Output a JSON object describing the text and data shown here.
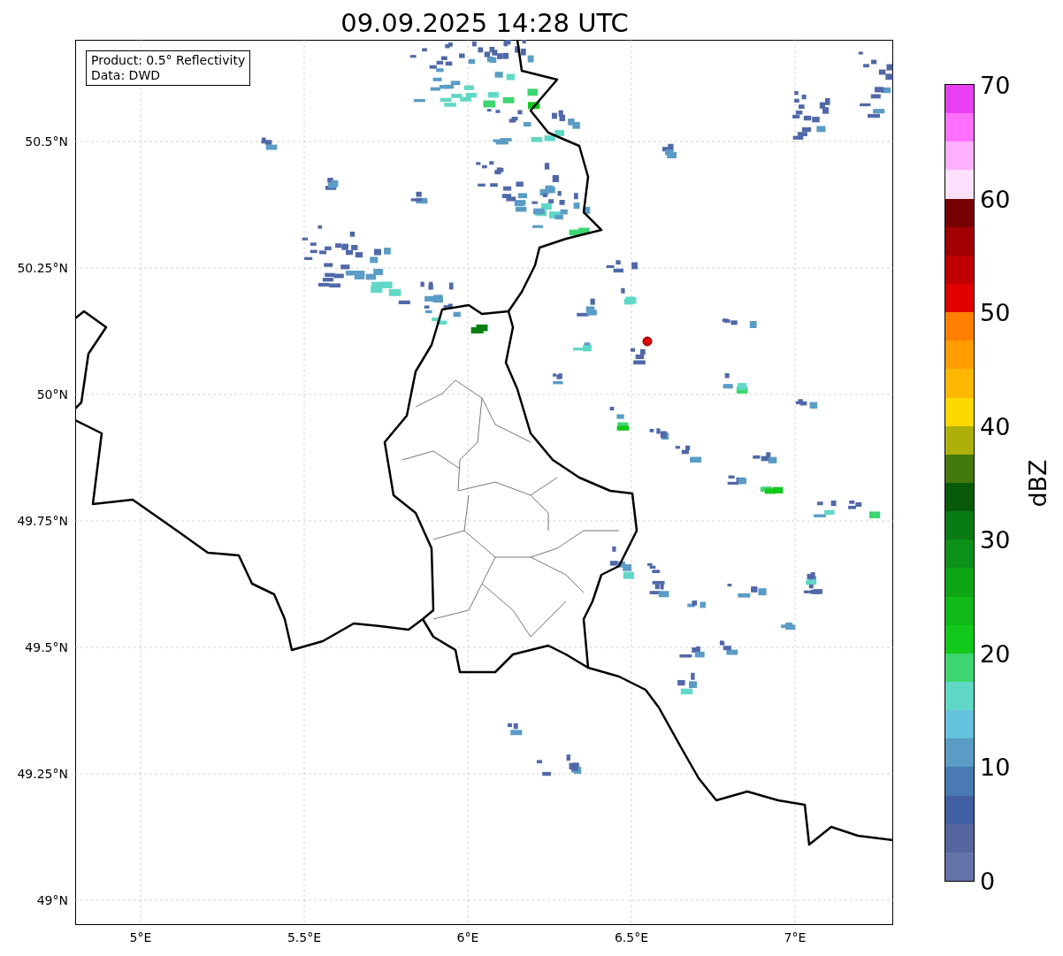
{
  "title": "09.09.2025 14:28 UTC",
  "info_box": [
    "Product: 0.5° Reflectivity",
    "Data: DWD"
  ],
  "lat_ticks": [
    "50.5°N",
    "50.25°N",
    "50°N",
    "49.75°N",
    "49.5°N",
    "49.25°N",
    "49°N"
  ],
  "lon_ticks": [
    "5°E",
    "5.5°E",
    "6°E",
    "6.5°E",
    "7°E"
  ],
  "colorbar": {
    "label": "dBZ",
    "ticks": [
      "70",
      "60",
      "50",
      "40",
      "30",
      "20",
      "10",
      "0"
    ],
    "segments": [
      {
        "color": "#e840f0"
      },
      {
        "color": "#ff70ff"
      },
      {
        "color": "#ffb0ff"
      },
      {
        "color": "#ffe0ff"
      },
      {
        "color": "#780000"
      },
      {
        "color": "#a00000"
      },
      {
        "color": "#c00000"
      },
      {
        "color": "#e00000"
      },
      {
        "color": "#ff8000"
      },
      {
        "color": "#ff9c00"
      },
      {
        "color": "#ffb800"
      },
      {
        "color": "#ffd800"
      },
      {
        "color": "#aeb00a"
      },
      {
        "color": "#447a0c"
      },
      {
        "color": "#085a0a"
      },
      {
        "color": "#0a7a12"
      },
      {
        "color": "#0c9018"
      },
      {
        "color": "#0ea614"
      },
      {
        "color": "#10b818"
      },
      {
        "color": "#12c81a"
      },
      {
        "color": "#3dd670"
      },
      {
        "color": "#60d8c6"
      },
      {
        "color": "#64c2dc"
      },
      {
        "color": "#5a9cc6"
      },
      {
        "color": "#4a7ab4"
      },
      {
        "color": "#4460a4"
      },
      {
        "color": "#5566a0"
      },
      {
        "color": "#6474a8"
      }
    ]
  }
}
